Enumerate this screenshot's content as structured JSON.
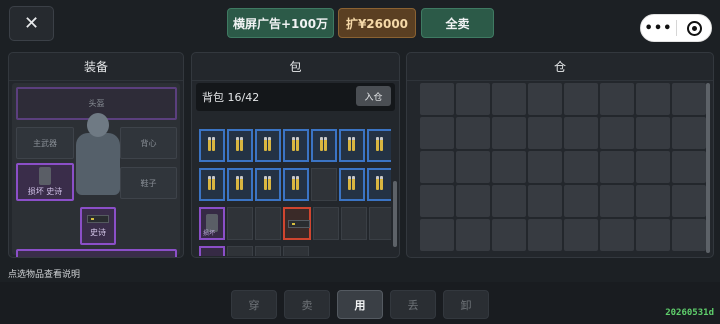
{
  "top_bar": {
    "close_icon": "close-icon",
    "ad_button": "横屏广告+100万",
    "expand_button": "扩¥26000",
    "sell_all_button": "全卖",
    "capsule_more": "•••",
    "capsule_target_icon": "target-icon"
  },
  "equipment": {
    "title": "装备",
    "head_slot": "头盔",
    "weapon_slot": "主武器",
    "back_slot": "背心",
    "shoes_slot": "鞋子",
    "armor_item_label": "损坏 史诗",
    "bottom_item_label": "史诗"
  },
  "bag": {
    "title": "包",
    "capacity_label": "背包 16/42",
    "store_button": "入仓",
    "bottom_cell_label": "损坏",
    "row1_items": 7,
    "row2_items": 6
  },
  "warehouse": {
    "title": "仓",
    "columns": 8,
    "rows": 5
  },
  "hint": "点选物品查看说明",
  "actions": {
    "wear": "穿",
    "sell": "卖",
    "use": "用",
    "drop": "丢",
    "unload": "卸",
    "active": "use"
  },
  "version": "20260531d",
  "colors": {
    "accent_green": "#2c5a48",
    "accent_gold": "#5a3f22",
    "rarity_blue": "#3b74c4",
    "rarity_purple": "#8b4fc8",
    "rarity_red": "#d0452f",
    "version_green": "#5fcf6c"
  }
}
